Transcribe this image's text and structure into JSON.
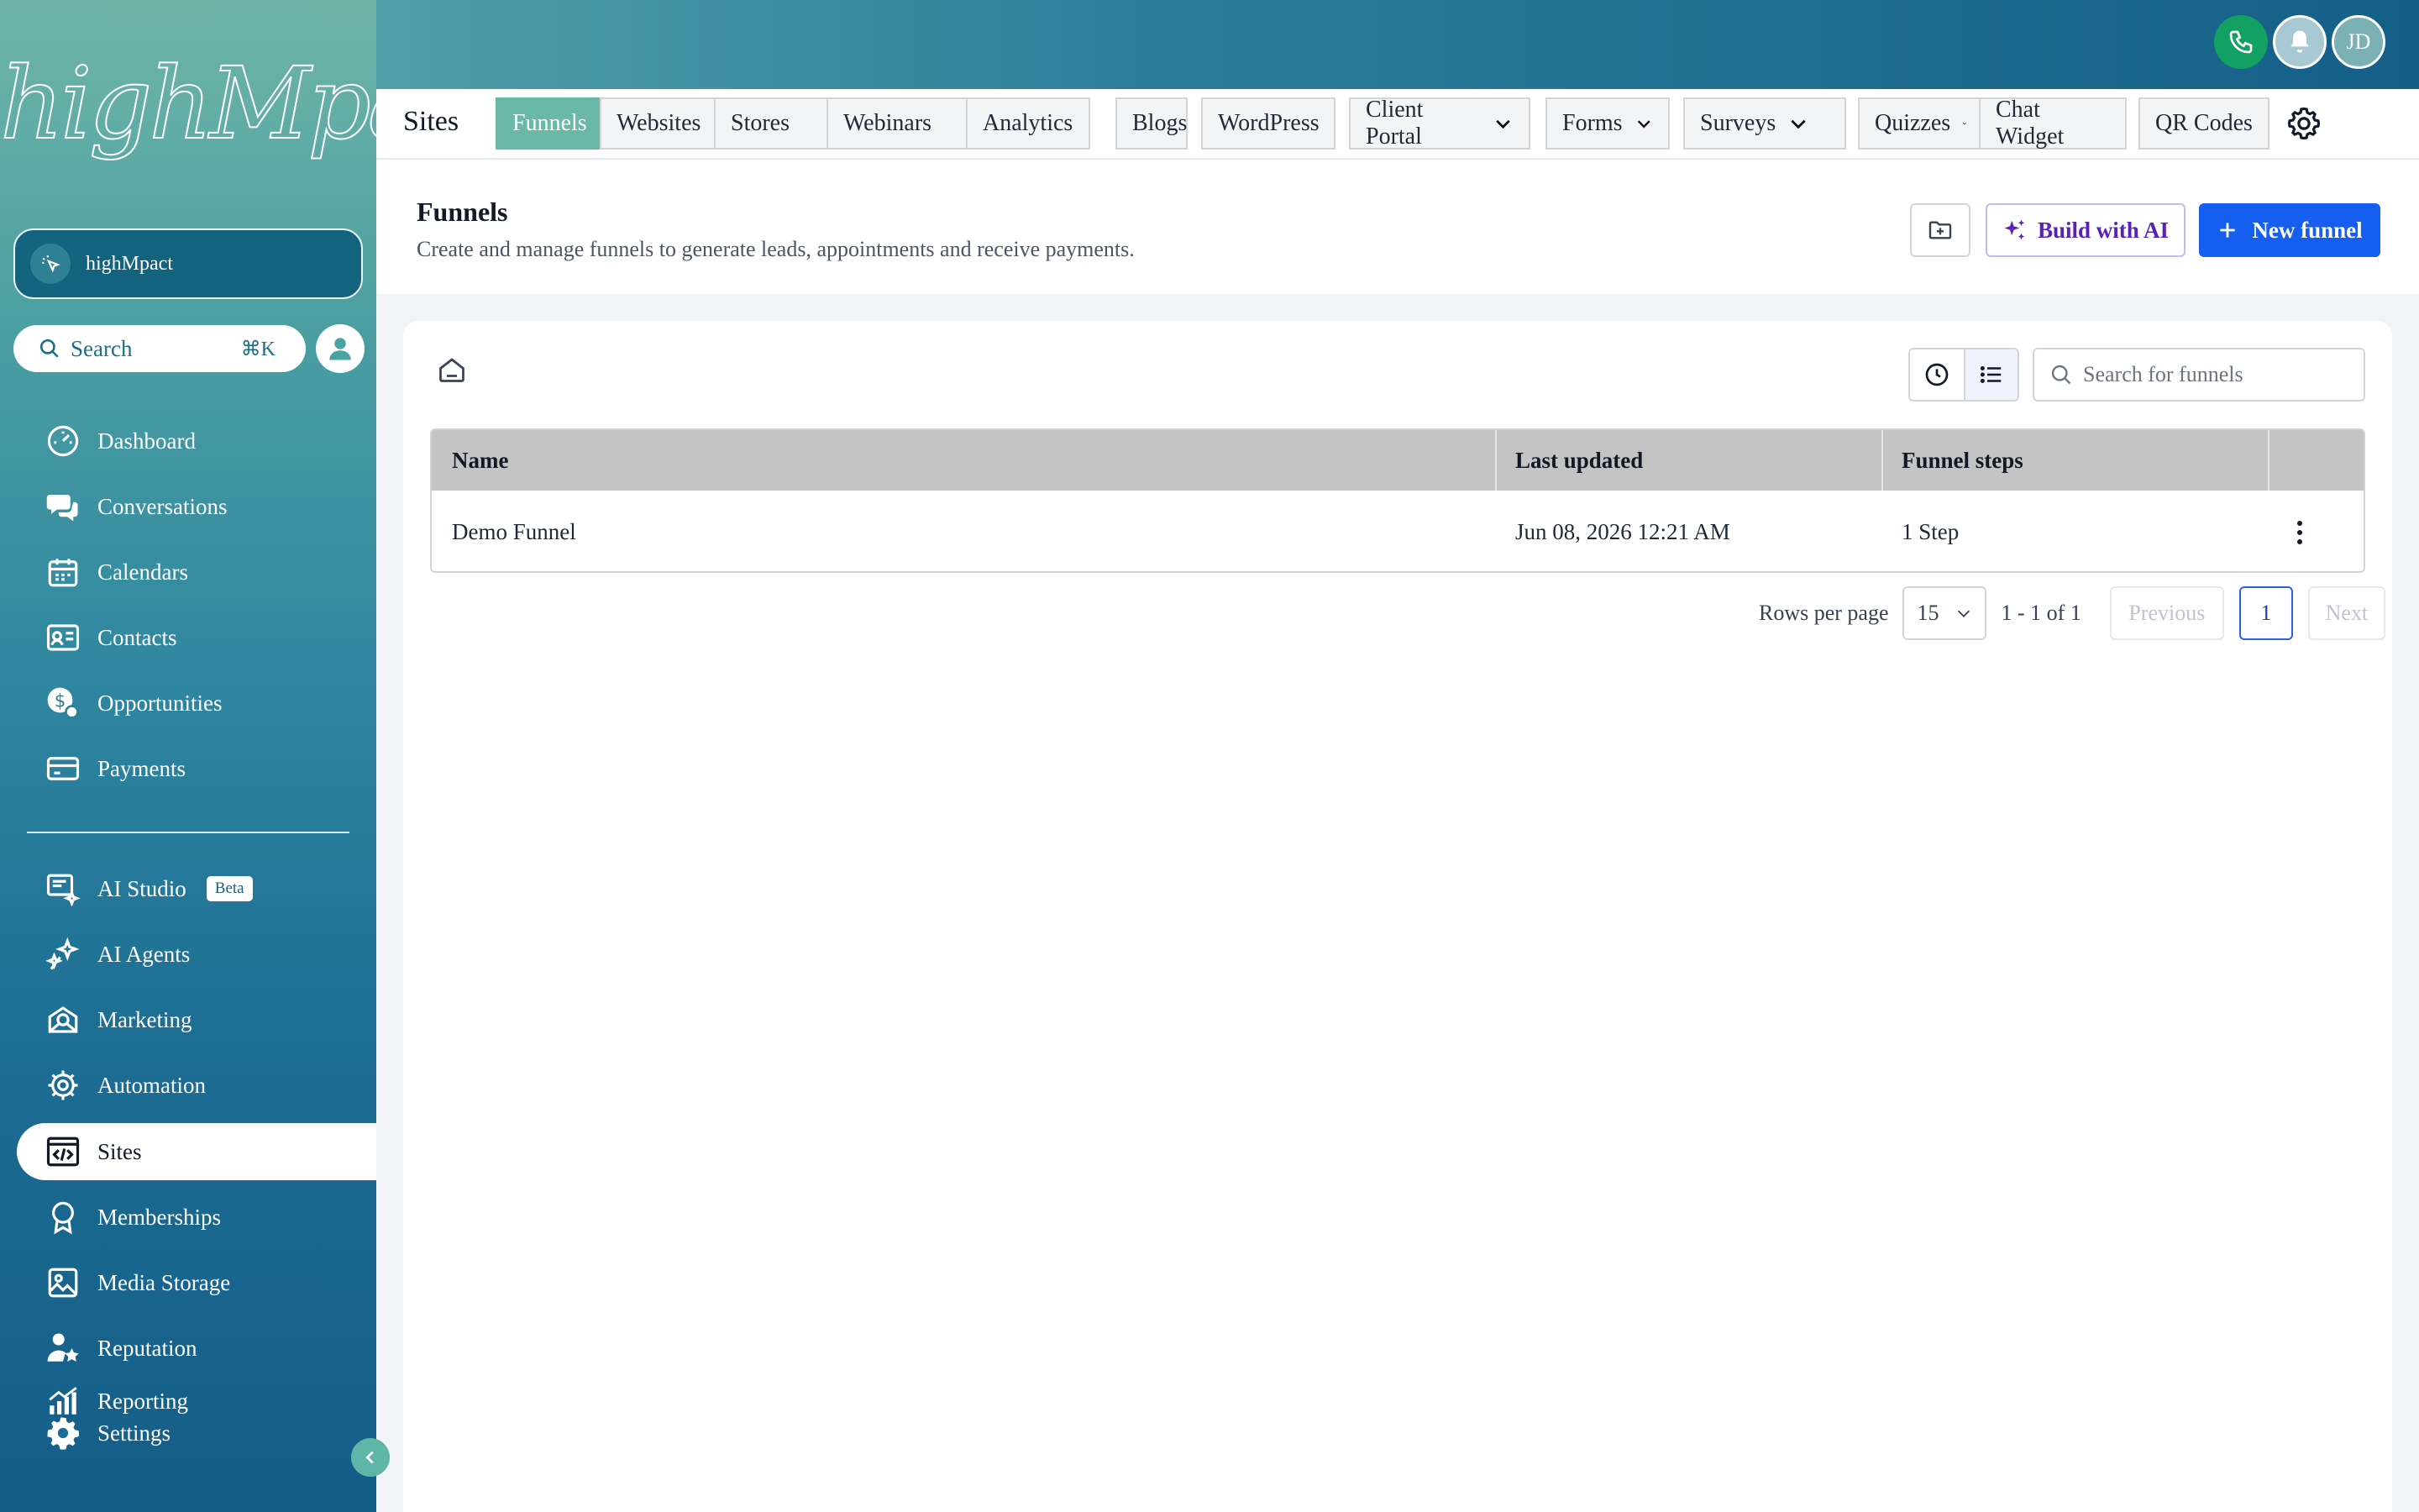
{
  "brand": {
    "logo_text": "highMpact",
    "account_name": "highMpact"
  },
  "sidebar": {
    "search_label": "Search",
    "search_shortcut": "⌘K",
    "items": [
      {
        "label": "Dashboard",
        "icon": "dashboard-icon"
      },
      {
        "label": "Conversations",
        "icon": "chat-icon"
      },
      {
        "label": "Calendars",
        "icon": "calendar-icon"
      },
      {
        "label": "Contacts",
        "icon": "contacts-icon"
      },
      {
        "label": "Opportunities",
        "icon": "opportunities-icon"
      },
      {
        "label": "Payments",
        "icon": "payments-icon"
      },
      {
        "label": "AI Studio",
        "icon": "ai-studio-icon",
        "badge": "Beta"
      },
      {
        "label": "AI Agents",
        "icon": "ai-agents-icon"
      },
      {
        "label": "Marketing",
        "icon": "marketing-icon"
      },
      {
        "label": "Automation",
        "icon": "automation-icon"
      },
      {
        "label": "Sites",
        "icon": "sites-icon",
        "active": true
      },
      {
        "label": "Memberships",
        "icon": "memberships-icon"
      },
      {
        "label": "Media Storage",
        "icon": "media-icon"
      },
      {
        "label": "Reputation",
        "icon": "reputation-icon"
      },
      {
        "label": "Reporting",
        "icon": "reporting-icon"
      },
      {
        "label": "Settings",
        "icon": "gear-icon"
      }
    ]
  },
  "header": {
    "avatar_initials": "JD"
  },
  "tabs": {
    "section_title": "Sites",
    "items": [
      {
        "label": "Funnels",
        "active": true
      },
      {
        "label": "Websites"
      },
      {
        "label": "Stores"
      },
      {
        "label": "Webinars"
      },
      {
        "label": "Analytics"
      },
      {
        "label": "Blogs"
      },
      {
        "label": "WordPress"
      },
      {
        "label": "Client Portal",
        "dropdown": true
      },
      {
        "label": "Forms",
        "dropdown": true
      },
      {
        "label": "Surveys",
        "dropdown": true
      },
      {
        "label": "Quizzes",
        "dropdown": true
      },
      {
        "label": "Chat Widget"
      },
      {
        "label": "QR Codes"
      }
    ]
  },
  "page": {
    "title": "Funnels",
    "subtitle": "Create and manage funnels to generate leads, appointments and receive payments.",
    "build_ai_label": "Build with AI",
    "new_funnel_label": "New funnel",
    "search_placeholder": "Search for funnels"
  },
  "table": {
    "columns": [
      "Name",
      "Last updated",
      "Funnel steps"
    ],
    "rows": [
      {
        "name": "Demo Funnel",
        "last_updated": "Jun 08, 2026 12:21 AM",
        "steps": "1 Step"
      }
    ]
  },
  "pagination": {
    "rows_per_page_label": "Rows per page",
    "rows_per_page": "15",
    "range": "1 - 1 of 1",
    "previous": "Previous",
    "current_page": "1",
    "next": "Next"
  },
  "colors": {
    "accent_teal": "#6ab8a8",
    "primary_blue": "#155eef",
    "ai_purple": "#5b21b6",
    "phone_green": "#13a163"
  }
}
